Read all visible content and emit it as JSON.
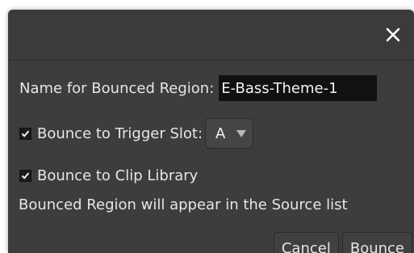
{
  "dialog": {
    "close_icon": "close-icon",
    "name_label": "Name for Bounced Region:",
    "name_value": "E-Bass-Theme-1",
    "trigger_checkbox_checked": true,
    "trigger_label": "Bounce to Trigger Slot:",
    "trigger_slot_value": "A",
    "clip_checkbox_checked": true,
    "clip_label": "Bounce to Clip Library",
    "info_text": "Bounced Region will appear in the Source list",
    "cancel_label": "Cancel",
    "bounce_label": "Bounce"
  },
  "colors": {
    "background": "#3d3d3d",
    "text": "#e6e6e6",
    "input_background": "#111111"
  }
}
